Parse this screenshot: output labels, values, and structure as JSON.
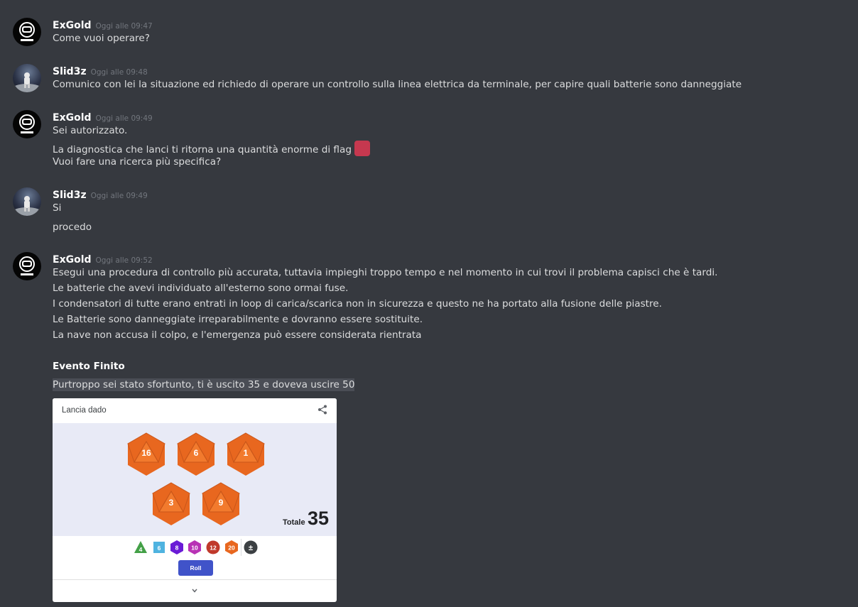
{
  "messages": [
    {
      "username": "ExGold",
      "timestamp": "Oggi alle 09:47",
      "lines": [
        "Come vuoi operare?"
      ]
    },
    {
      "username": "Slid3z",
      "timestamp": "Oggi alle 09:48",
      "lines": [
        "Comunico con lei la situazione ed richiedo di operare un controllo sulla linea elettrica da terminale, per capire quali batterie sono danneggiate"
      ]
    },
    {
      "username": "ExGold",
      "timestamp": "Oggi alle 09:49",
      "lines": [
        "Sei autorizzato.",
        "La diagnostica che lanci ti ritorna una quantità enorme di flag",
        "Vuoi fare una ricerca più specifica?"
      ]
    },
    {
      "username": "Slid3z",
      "timestamp": "Oggi alle 09:49",
      "lines": [
        "Si",
        "procedo"
      ]
    },
    {
      "username": "ExGold",
      "timestamp": "Oggi alle 09:52",
      "lines": [
        "Esegui una procedura di controllo più accurata, tuttavia impieghi troppo tempo e nel momento in cui trovi il problema capisci che è tardi.",
        "Le batterie che avevi individuato all'esterno sono ormai fuse.",
        "I condensatori di tutte erano entrati in loop di carica/scarica non in sicurezza e questo ne ha portato alla fusione delle piastre.",
        "Le Batterie sono danneggiate irreparabilmente e dovranno essere sostituite.",
        "La nave non accusa il colpo, e l'emergenza può essere considerata rientrata",
        "Evento Finito",
        "Purtroppo sei stato sfortunto, ti è uscito 35 e doveva uscire 50"
      ]
    }
  ],
  "flag_color": "#c6384f",
  "dice_card": {
    "title": "Lancia dado",
    "dice": [
      "16",
      "6",
      "1",
      "3",
      "9"
    ],
    "total_label": "Totale",
    "total_value": "35",
    "die_types": [
      "4",
      "6",
      "8",
      "10",
      "12",
      "20",
      "±"
    ],
    "roll_label": "Roll",
    "die_color": "#e8671f"
  }
}
